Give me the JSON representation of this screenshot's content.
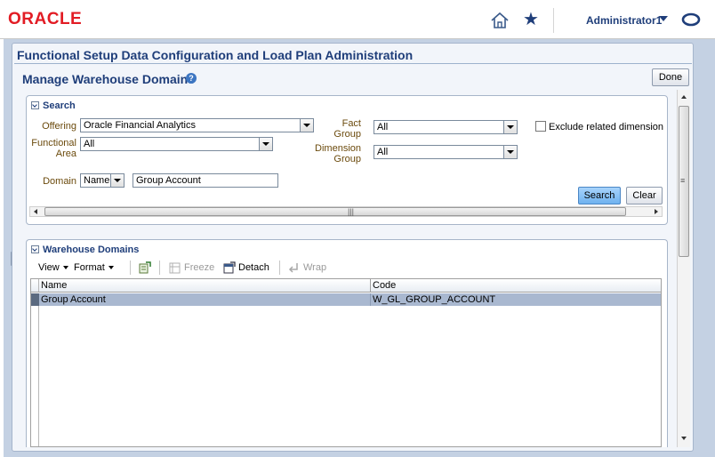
{
  "brand": {
    "logo_text": "ORACLE"
  },
  "header": {
    "user_label": "Administrator1"
  },
  "app": {
    "title": "Functional Setup Data Configuration and Load Plan Administration"
  },
  "page": {
    "title": "Manage Warehouse Domains",
    "done_label": "Done"
  },
  "search": {
    "heading": "Search",
    "offering_label": "Offering",
    "offering_value": "Oracle Financial Analytics",
    "functional_area_label_1": "Functional",
    "functional_area_label_2": "Area",
    "functional_area_value": "All",
    "fact_group_label_1": "Fact",
    "fact_group_label_2": "Group",
    "fact_group_value": "All",
    "dimension_group_label_1": "Dimension",
    "dimension_group_label_2": "Group",
    "dimension_group_value": "All",
    "exclude_label": "Exclude related dimension gro",
    "domain_label": "Domain",
    "domain_type_value": "Name",
    "domain_value": "Group Account",
    "search_button": "Search",
    "clear_button": "Clear"
  },
  "domains": {
    "heading": "Warehouse Domains",
    "toolbar": {
      "view": "View",
      "format": "Format",
      "freeze": "Freeze",
      "detach": "Detach",
      "wrap": "Wrap"
    },
    "columns": [
      "Name",
      "Code"
    ],
    "rows": [
      {
        "name": "Group Account",
        "code": "W_GL_GROUP_ACCOUNT"
      }
    ]
  },
  "colors": {
    "brand_red": "#e21c24",
    "title_blue": "#1f3e7a",
    "label_brown": "#6b4a0c",
    "selected_row": "#a9b8d0"
  },
  "icons": [
    "home-icon",
    "favorites-star-icon",
    "user-caret-icon",
    "oracle-o-icon",
    "help-icon",
    "disclosure-icon",
    "export-icon",
    "freeze-icon",
    "detach-icon",
    "wrap-icon"
  ]
}
